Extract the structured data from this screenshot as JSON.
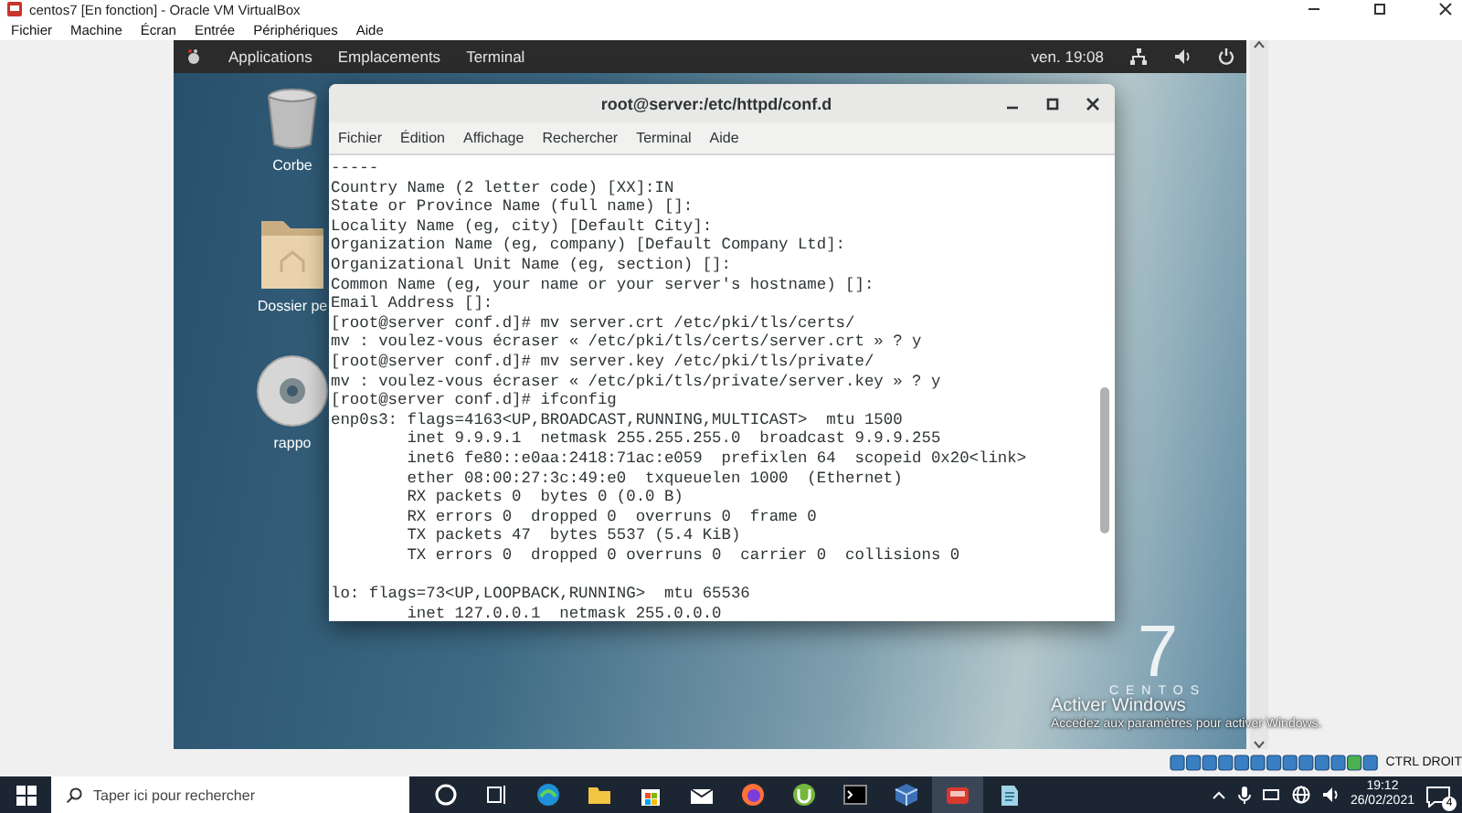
{
  "window": {
    "title": "centos7 [En fonction] - Oracle VM VirtualBox"
  },
  "menu": [
    "Fichier",
    "Machine",
    "Écran",
    "Entrée",
    "Périphériques",
    "Aide"
  ],
  "guest_topbar": {
    "items": [
      "Applications",
      "Emplacements",
      "Terminal"
    ],
    "clock": "ven. 19:08"
  },
  "desktop_icons": [
    {
      "kind": "trash",
      "label": "Corbe"
    },
    {
      "kind": "folder",
      "label": "Dossier pe"
    },
    {
      "kind": "disc",
      "label": "rappo"
    }
  ],
  "terminal": {
    "title": "root@server:/etc/httpd/conf.d",
    "menu": [
      "Fichier",
      "Édition",
      "Affichage",
      "Rechercher",
      "Terminal",
      "Aide"
    ],
    "blocks": [
      [
        "-----",
        "Country Name (2 letter code) [XX]:IN",
        "State or Province Name (full name) []:",
        "Locality Name (eg, city) [Default City]:",
        "Organization Name (eg, company) [Default Company Ltd]:",
        "Organizational Unit Name (eg, section) []:",
        "Common Name (eg, your name or your server's hostname) []:",
        "Email Address []:",
        "[root@server conf.d]# mv server.crt /etc/pki/tls/certs/",
        "mv : voulez-vous écraser « /etc/pki/tls/certs/server.crt » ? y",
        "[root@server conf.d]# mv server.key /etc/pki/tls/private/",
        "mv : voulez-vous écraser « /etc/pki/tls/private/server.key » ? y",
        "[root@server conf.d]# ifconfig",
        "enp0s3: flags=4163<UP,BROADCAST,RUNNING,MULTICAST>  mtu 1500",
        "        inet 9.9.9.1  netmask 255.255.255.0  broadcast 9.9.9.255",
        "        inet6 fe80::e0aa:2418:71ac:e059  prefixlen 64  scopeid 0x20<link>",
        "        ether 08:00:27:3c:49:e0  txqueuelen 1000  (Ethernet)",
        "        RX packets 0  bytes 0 (0.0 B)",
        "        RX errors 0  dropped 0  overruns 0  frame 0",
        "        TX packets 47  bytes 5537 (5.4 KiB)",
        "        TX errors 0  dropped 0 overruns 0  carrier 0  collisions 0"
      ],
      [
        "lo: flags=73<UP,LOOPBACK,RUNNING>  mtu 65536",
        "        inet 127.0.0.1  netmask 255.0.0.0"
      ]
    ]
  },
  "os_logo": {
    "version": "7",
    "name": "CENTOS"
  },
  "activation_notice": {
    "title": "Activer Windows",
    "text": "Accédez aux paramètres pour activer Windows."
  },
  "vm_status": {
    "host_key": "CTRL DROIT"
  },
  "taskbar": {
    "search": {
      "placeholder": "Taper ici pour rechercher"
    },
    "time": "19:12",
    "date": "26/02/2021",
    "notifications": "4"
  }
}
